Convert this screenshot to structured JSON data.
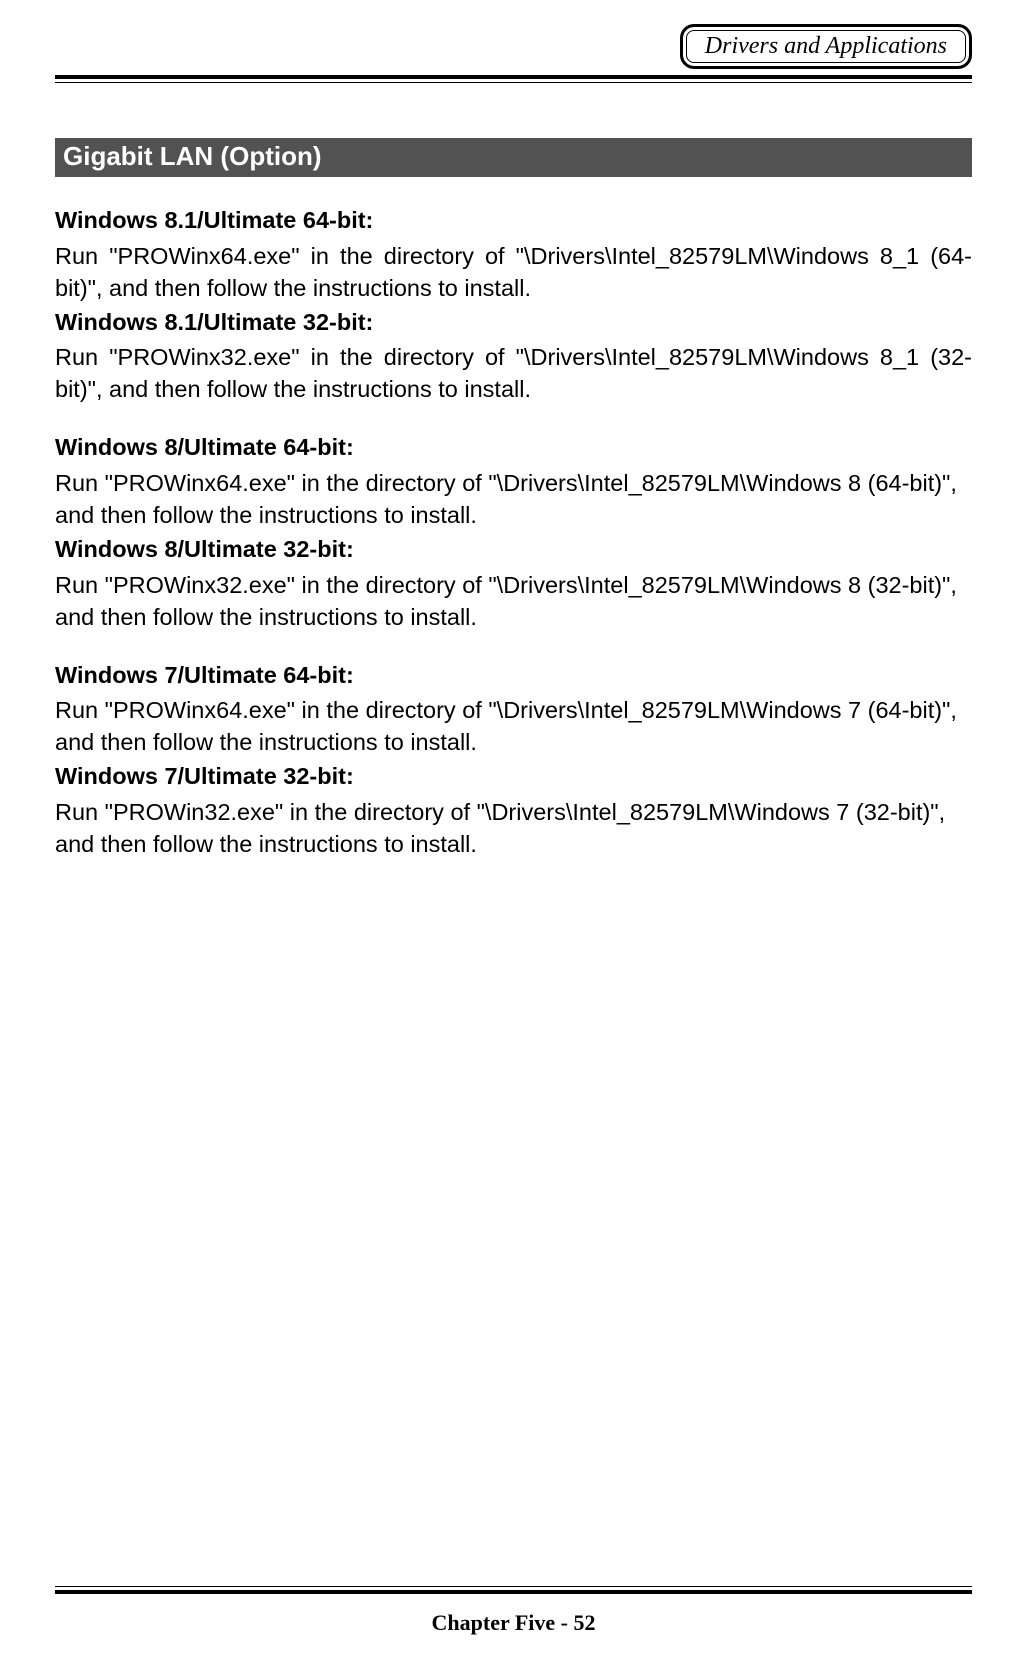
{
  "header": {
    "badge": "Drivers and Applications"
  },
  "section": {
    "title": " Gigabit LAN (Option)"
  },
  "entries": [
    {
      "heading": "Windows 8.1/Ultimate 64-bit:",
      "body": "Run \"PROWinx64.exe\" in the directory of \"\\Drivers\\Intel_82579LM\\Windows 8_1 (64-bit)\", and then follow the instructions to install.",
      "justify": true,
      "groupEnd": false
    },
    {
      "heading": "Windows 8.1/Ultimate 32-bit:",
      "body": "Run \"PROWinx32.exe\" in the directory of \"\\Drivers\\Intel_82579LM\\Windows 8_1 (32-bit)\", and then follow the instructions to install.",
      "justify": true,
      "groupEnd": true
    },
    {
      "heading": "Windows 8/Ultimate 64-bit:",
      "body": "Run \"PROWinx64.exe\" in the directory of \"\\Drivers\\Intel_82579LM\\Windows 8 (64-bit)\", and then follow the instructions to install.",
      "justify": false,
      "groupEnd": false
    },
    {
      "heading": "Windows 8/Ultimate 32-bit:",
      "body": "Run \"PROWinx32.exe\" in the directory of \"\\Drivers\\Intel_82579LM\\Windows 8 (32-bit)\", and then follow the instructions to install.",
      "justify": false,
      "groupEnd": true
    },
    {
      "heading": "Windows 7/Ultimate 64-bit:",
      "body": "Run \"PROWinx64.exe\" in the directory of \"\\Drivers\\Intel_82579LM\\Windows 7 (64-bit)\", and then follow the instructions to install.",
      "justify": false,
      "groupEnd": false
    },
    {
      "heading": "Windows 7/Ultimate 32-bit:",
      "body": "Run \"PROWin32.exe\" in the directory of \"\\Drivers\\Intel_82579LM\\Windows 7 (32-bit)\", and then follow the instructions to install.",
      "justify": false,
      "groupEnd": true
    }
  ],
  "footer": {
    "text": "Chapter Five - 52"
  }
}
